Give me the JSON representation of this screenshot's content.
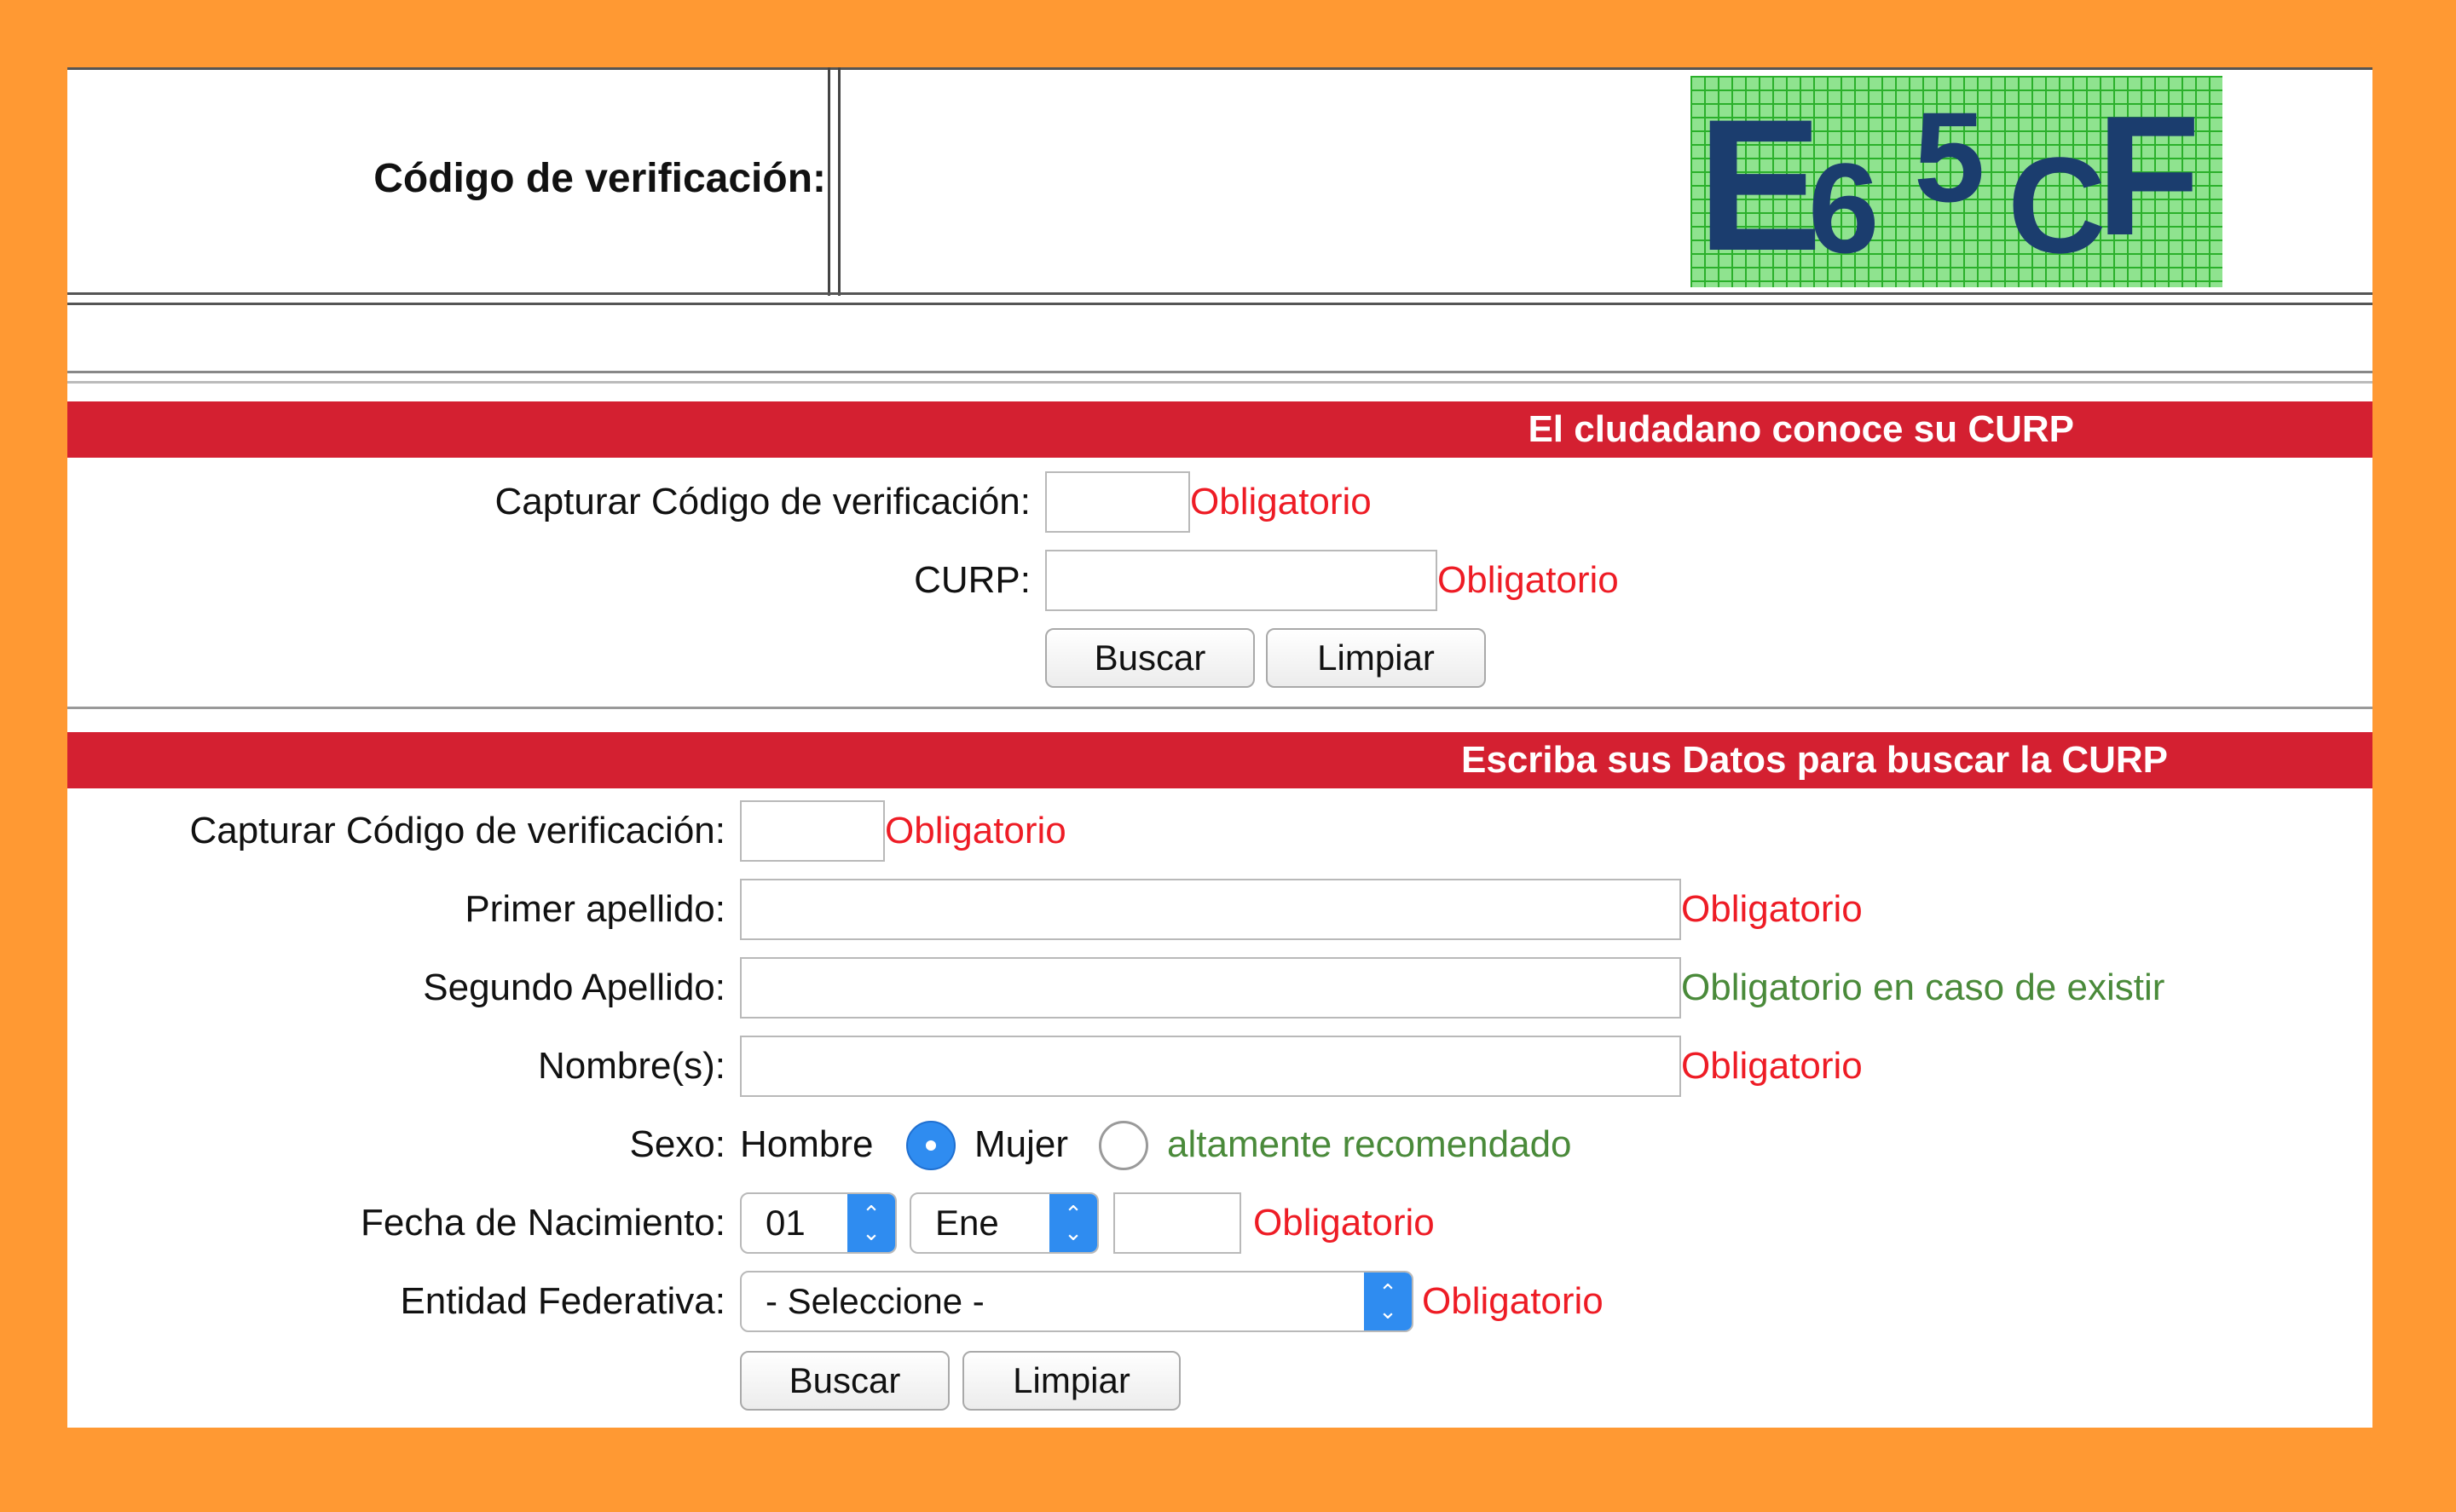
{
  "captcha": {
    "label": "Código de verificación:",
    "chars": [
      "E",
      "6",
      "5",
      "C",
      "F"
    ]
  },
  "section1": {
    "title": "El cludadano conoce su CURP",
    "captcha_label": "Capturar Código de verificación:",
    "captcha_required": "Obligatorio",
    "curp_label": "CURP:",
    "curp_required": "Obligatorio",
    "search_button": "Buscar",
    "clear_button": "Limpiar"
  },
  "section2": {
    "title": "Escriba sus Datos para buscar la CURP",
    "captcha_label": "Capturar Código de verificación:",
    "captcha_required": "Obligatorio",
    "first_surname_label": "Primer apellido:",
    "first_surname_required": "Obligatorio",
    "second_surname_label": "Segundo Apellido:",
    "second_surname_note": "Obligatorio en caso de existir",
    "names_label": "Nombre(s):",
    "names_required": "Obligatorio",
    "sex_label": "Sexo:",
    "sex_male": "Hombre",
    "sex_female": "Mujer",
    "sex_note": "altamente recomendado",
    "birth_label": "Fecha de Nacimiento:",
    "birth_day": "01",
    "birth_month": "Ene",
    "birth_required": "Obligatorio",
    "state_label": "Entidad Federativa:",
    "state_placeholder": "- Seleccione -",
    "state_required": "Obligatorio",
    "search_button": "Buscar",
    "clear_button": "Limpiar"
  },
  "colors": {
    "page_background": "#FF9933",
    "section_bar": "#d42031",
    "required_text": "#ee1c25",
    "recommended_text": "#4a8a3a",
    "select_accent": "#2f8cf0"
  }
}
